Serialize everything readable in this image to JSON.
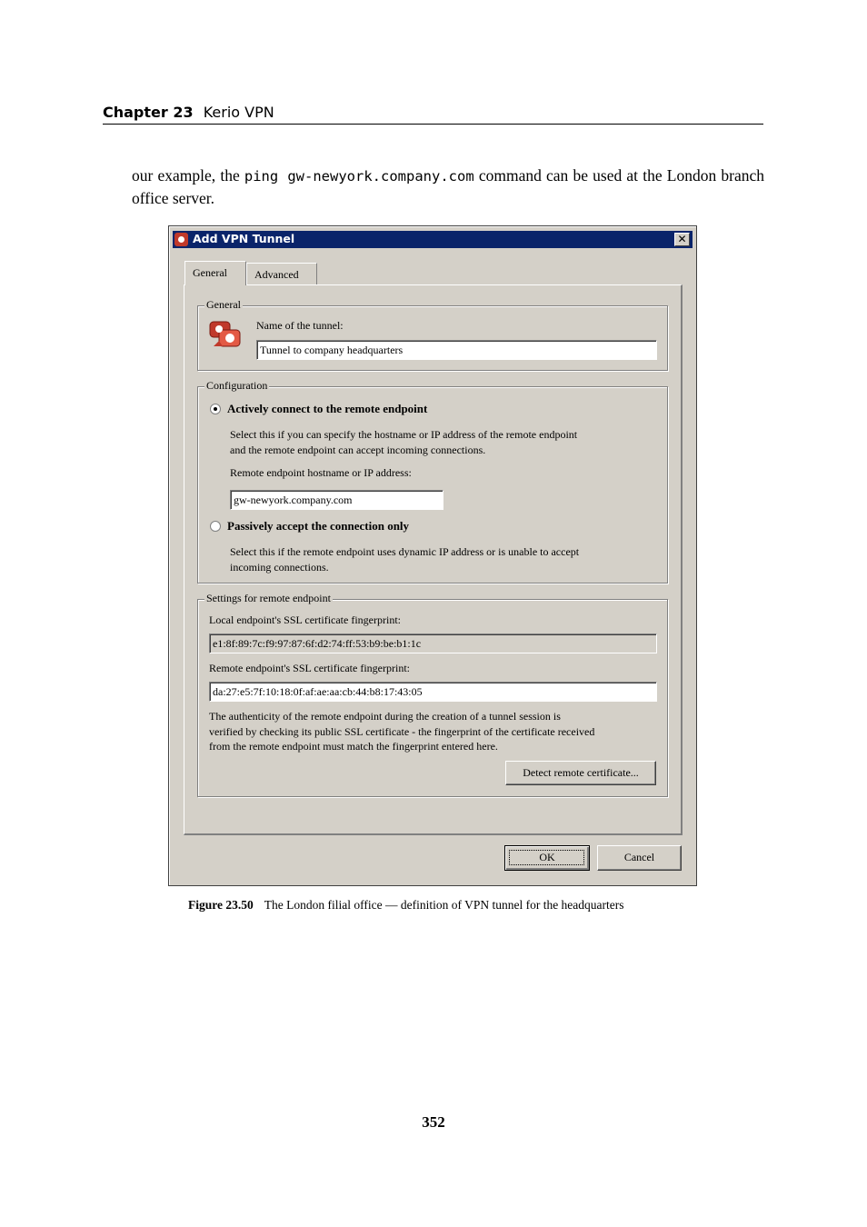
{
  "header": {
    "chapter_number": "Chapter 23",
    "chapter_title": "Kerio VPN"
  },
  "body": {
    "text_before": "our example, the ",
    "code": "ping gw-newyork.company.com",
    "text_after": " command can be used at the London branch office server."
  },
  "dialog": {
    "title": "Add VPN Tunnel",
    "close_symbol": "✕",
    "tabs": [
      {
        "label": "General",
        "active": true
      },
      {
        "label": "Advanced",
        "active": false
      }
    ],
    "general_group": {
      "label": "General",
      "name_label": "Name of the tunnel:",
      "name_value": "Tunnel to company headquarters"
    },
    "configuration_group": {
      "label": "Configuration",
      "option_active": {
        "label": "Actively connect to the remote endpoint",
        "checked": true,
        "description_line1": "Select this if you can specify the hostname or IP address of the remote endpoint",
        "description_line2": "and the remote endpoint can accept incoming connections.",
        "hostname_label": "Remote endpoint hostname or IP address:",
        "hostname_value": "gw-newyork.company.com"
      },
      "option_passive": {
        "label": "Passively accept the connection only",
        "checked": false,
        "description_line1": "Select this if the remote endpoint uses dynamic IP address or is unable to accept",
        "description_line2": "incoming connections."
      }
    },
    "remote_settings_group": {
      "label": "Settings for remote endpoint",
      "local_fp_label": "Local endpoint's SSL certificate fingerprint:",
      "local_fp_value": "e1:8f:89:7c:f9:97:87:6f:d2:74:ff:53:b9:be:b1:1c",
      "remote_fp_label": "Remote endpoint's SSL certificate fingerprint:",
      "remote_fp_value": "da:27:e5:7f:10:18:0f:af:ae:aa:cb:44:b8:17:43:05",
      "note_line1": "The authenticity of the remote endpoint during the creation of a tunnel session is",
      "note_line2": "verified by checking its public SSL certificate - the fingerprint of the certificate received",
      "note_line3": "from the remote endpoint must match the fingerprint entered here.",
      "detect_button": "Detect remote certificate..."
    },
    "ok_button": "OK",
    "cancel_button": "Cancel"
  },
  "caption": {
    "figure_number": "Figure 23.50",
    "text": "The London filial office — definition of VPN tunnel for the headquarters"
  },
  "page_number": "352",
  "colors": {
    "titlebar": "#0a246a",
    "dialog_face": "#d4d0c8",
    "icon_red": "#c0392b"
  }
}
